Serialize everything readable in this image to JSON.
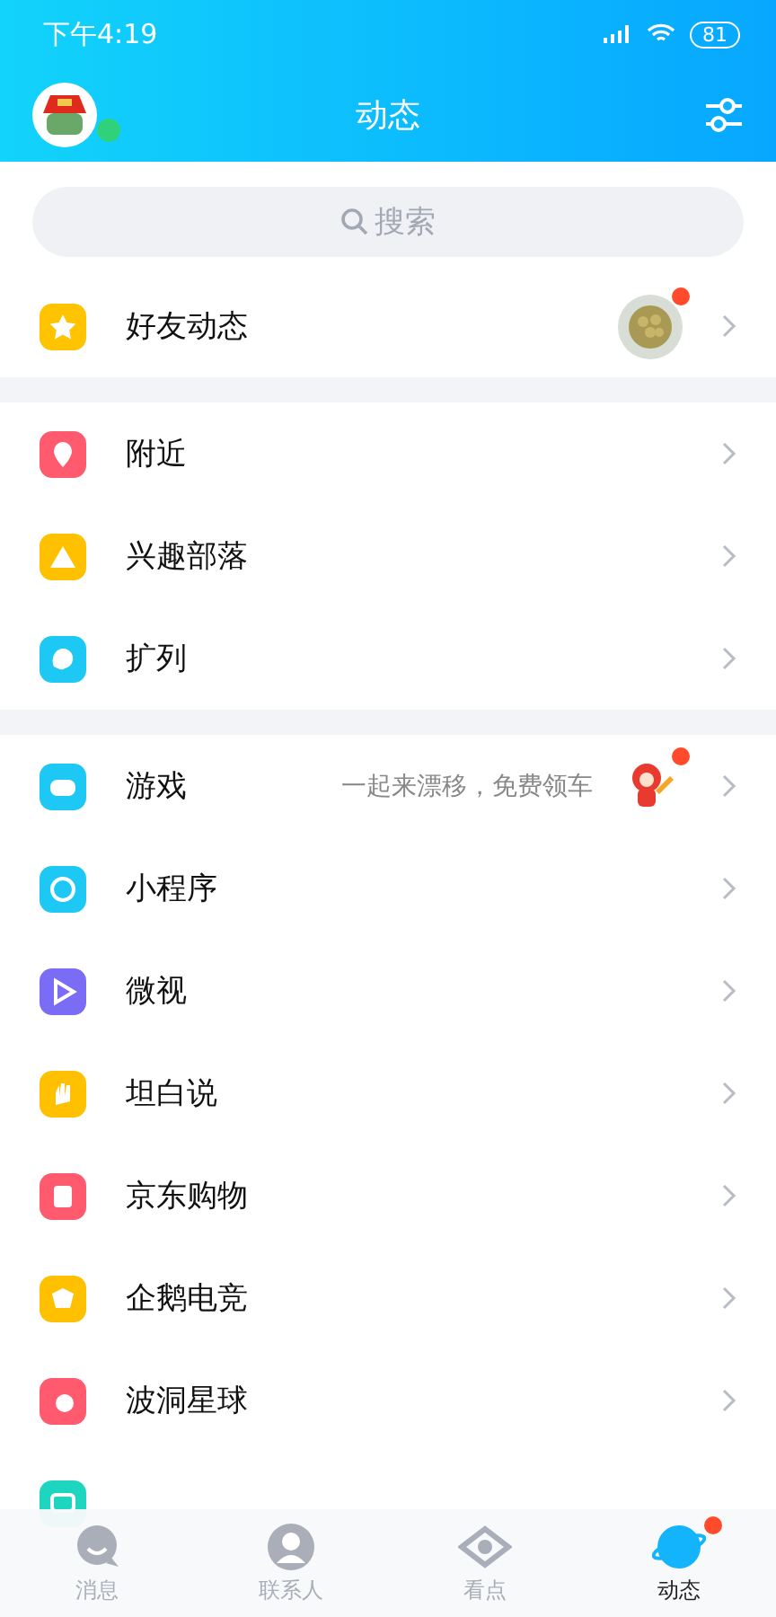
{
  "status_bar": {
    "time": "下午4:19",
    "battery": "81"
  },
  "header": {
    "title": "动态",
    "online": true
  },
  "search": {
    "placeholder": "搜索"
  },
  "sections": [
    {
      "items": [
        {
          "label": "好友动态",
          "color": "#ffc300",
          "badge": true
        }
      ]
    },
    {
      "items": [
        {
          "label": "附近",
          "color": "#ff5a6e",
          "badge": false
        },
        {
          "label": "兴趣部落",
          "color": "#ffc000",
          "badge": false
        },
        {
          "label": "扩列",
          "color": "#1ec8f5",
          "badge": false
        }
      ]
    },
    {
      "items": [
        {
          "label": "游戏",
          "color": "#1ec8f5",
          "badge": true,
          "subtitle": "一起来漂移，免费领车"
        },
        {
          "label": "小程序",
          "color": "#1ec8f5",
          "badge": false
        },
        {
          "label": "微视",
          "color": "#7b6cf5",
          "badge": false
        },
        {
          "label": "坦白说",
          "color": "#ffc000",
          "badge": false
        },
        {
          "label": "京东购物",
          "color": "#ff5a6e",
          "badge": false
        },
        {
          "label": "企鹅电竞",
          "color": "#ffc000",
          "badge": false
        },
        {
          "label": "波洞星球",
          "color": "#ff5a6e",
          "badge": false
        },
        {
          "color": "#1ed6c0"
        }
      ]
    }
  ],
  "tab_bar": [
    {
      "label": "消息",
      "selected": false,
      "badge": false
    },
    {
      "label": "联系人",
      "selected": false,
      "badge": false
    },
    {
      "label": "看点",
      "selected": false,
      "badge": false
    },
    {
      "label": "动态",
      "selected": true,
      "badge": true
    }
  ]
}
